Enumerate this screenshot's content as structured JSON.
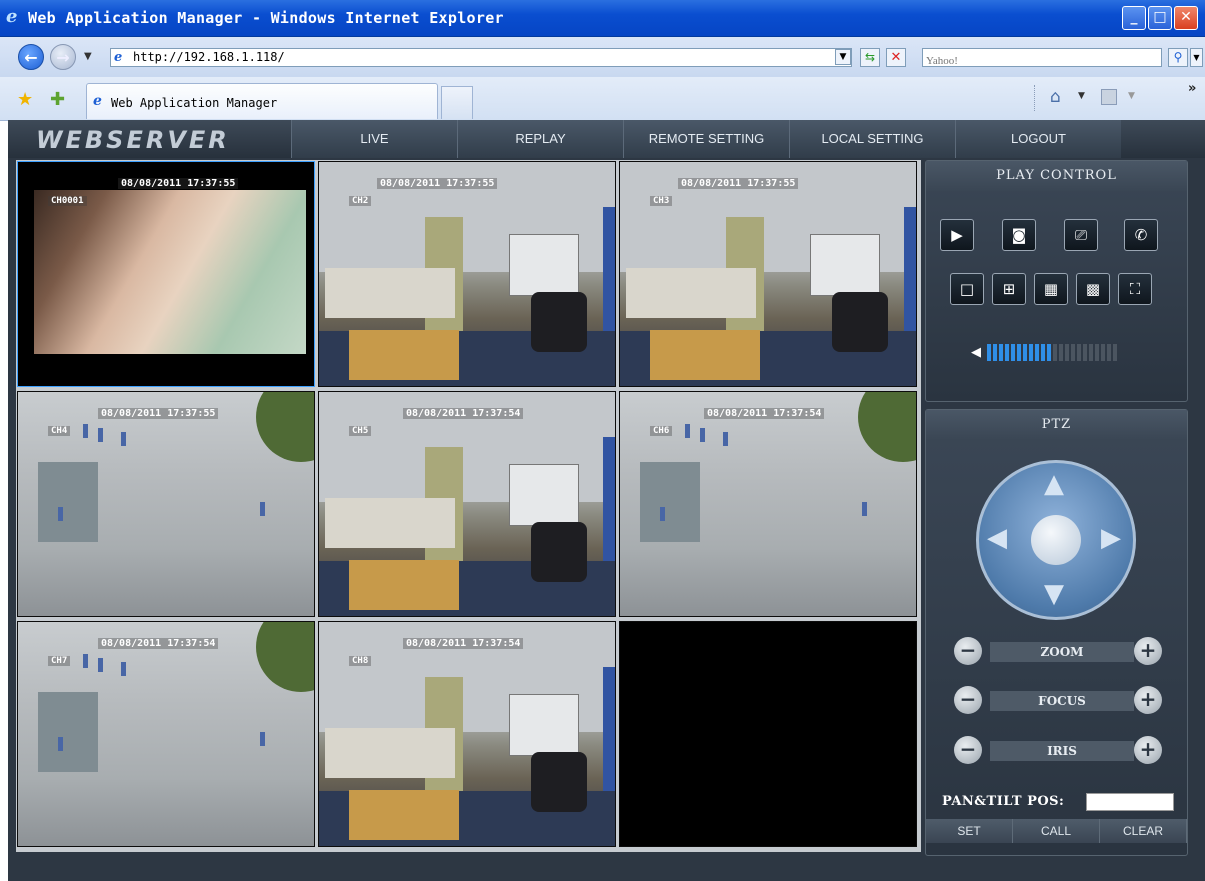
{
  "window": {
    "title": "Web Application Manager - Windows Internet Explorer",
    "buttons": {
      "minimize": "_",
      "maximize": "□",
      "close": "✕"
    }
  },
  "browser": {
    "back_label": "←",
    "forward_label": "→",
    "url": "http://192.168.1.118/",
    "search_placeholder": "Yahoo!",
    "tab_title": "Web Application Manager"
  },
  "app": {
    "logo": "WEBSERVER",
    "menu": [
      "LIVE",
      "REPLAY",
      "REMOTE SETTING",
      "LOCAL SETTING",
      "LOGOUT"
    ],
    "cameras": [
      {
        "channel": "CH0001",
        "timestamp": "08/08/2011 17:37:55"
      },
      {
        "channel": "CH2",
        "timestamp": "08/08/2011 17:37:55"
      },
      {
        "channel": "CH3",
        "timestamp": "08/08/2011 17:37:55"
      },
      {
        "channel": "CH4",
        "timestamp": "08/08/2011 17:37:55"
      },
      {
        "channel": "CH5",
        "timestamp": "08/08/2011 17:37:54"
      },
      {
        "channel": "CH6",
        "timestamp": "08/08/2011 17:37:54"
      },
      {
        "channel": "CH7",
        "timestamp": "08/08/2011 17:37:54"
      },
      {
        "channel": "CH8",
        "timestamp": "08/08/2011 17:37:54"
      }
    ],
    "play_control": {
      "title": "PLAY CONTROL",
      "volume_level": 0.5
    },
    "ptz": {
      "title": "PTZ",
      "zoom_label": "ZOOM",
      "focus_label": "FOCUS",
      "iris_label": "IRIS",
      "pos_label": "PAN&TILT POS:",
      "pos_value": "",
      "set_label": "SET",
      "call_label": "CALL",
      "clear_label": "CLEAR"
    }
  }
}
